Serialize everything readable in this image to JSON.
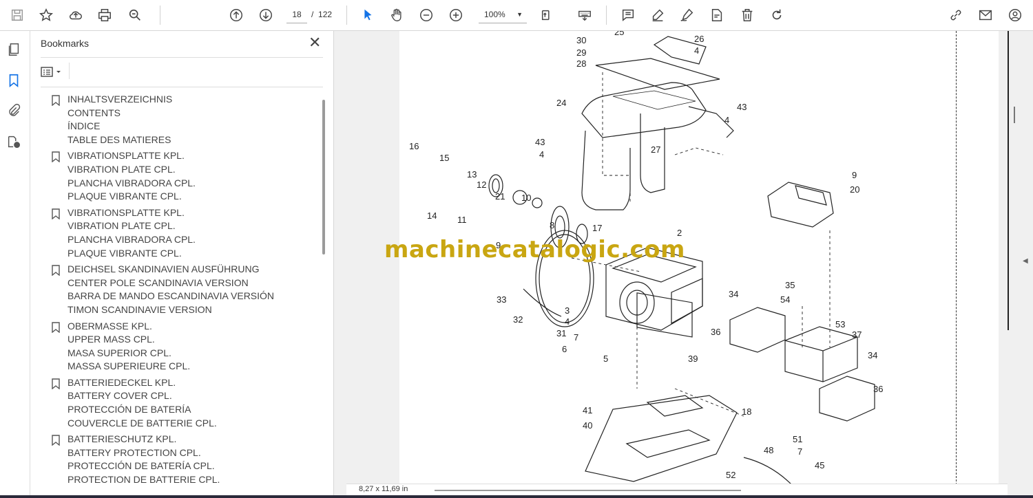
{
  "toolbar": {
    "icons": [
      "save-icon",
      "star-icon",
      "upload-cloud-icon",
      "print-icon",
      "zoom-search-icon",
      "page-up-icon",
      "page-down-icon",
      "select-arrow-icon",
      "hand-icon",
      "zoom-out-icon",
      "zoom-in-icon",
      "fit-page-icon",
      "keyboard-icon",
      "comment-icon",
      "highlight-pen-icon",
      "sign-pen-icon",
      "edit-stamp-icon",
      "trash-icon",
      "rotate-icon",
      "link-share-icon",
      "email-icon",
      "account-icon"
    ],
    "current_page": "18",
    "page_separator": "/",
    "total_pages": "122",
    "zoom_value": "100%"
  },
  "rail": {
    "icons": [
      "pages-icon",
      "bookmark-icon",
      "attachment-icon",
      "layers-lock-icon"
    ]
  },
  "bookmarks_panel": {
    "title": "Bookmarks",
    "items": [
      {
        "lines": [
          "INHALTSVERZEICHNIS",
          "CONTENTS",
          "ÍNDICE",
          "TABLE DES MATIERES"
        ]
      },
      {
        "lines": [
          "VIBRATIONSPLATTE KPL.",
          "VIBRATION PLATE CPL.",
          "PLANCHA VIBRADORA CPL.",
          "PLAQUE VIBRANTE CPL."
        ]
      },
      {
        "lines": [
          "VIBRATIONSPLATTE KPL.",
          "VIBRATION PLATE CPL.",
          "PLANCHA VIBRADORA CPL.",
          "PLAQUE VIBRANTE CPL."
        ]
      },
      {
        "lines": [
          "DEICHSEL SKANDINAVIEN AUSFÜHRUNG",
          "CENTER POLE SCANDINAVIA VERSION",
          "BARRA DE MANDO ESCANDINAVIA VERSIÓN",
          "TIMON SCANDINAVIE VERSION"
        ]
      },
      {
        "lines": [
          "OBERMASSE KPL.",
          "UPPER MASS CPL.",
          "MASA SUPERIOR CPL.",
          "MASSA SUPERIEURE CPL."
        ]
      },
      {
        "lines": [
          "BATTERIEDECKEL KPL.",
          "BATTERY COVER CPL.",
          "PROTECCIÓN DE BATERÍA",
          "COUVERCLE DE BATTERIE CPL."
        ]
      },
      {
        "lines": [
          "BATTERIESCHUTZ KPL.",
          "BATTERY PROTECTION CPL.",
          "PROTECCIÓN DE BATERÍA CPL.",
          "PROTECTION DE BATTERIE CPL."
        ]
      }
    ]
  },
  "document": {
    "watermark": "machinecatalogic.com",
    "page_size": "8,27 x 11,69 in",
    "part_numbers": [
      "30",
      "29",
      "28",
      "25",
      "26",
      "4",
      "24",
      "43",
      "4",
      "27",
      "43",
      "4",
      "16",
      "15",
      "13",
      "12",
      "14",
      "11",
      "21",
      "10",
      "9",
      "20",
      "8",
      "17",
      "2",
      "9",
      "33",
      "32",
      "3",
      "4",
      "31",
      "7",
      "6",
      "5",
      "35",
      "34",
      "54",
      "53",
      "36",
      "37",
      "39",
      "34",
      "36",
      "18",
      "41",
      "40",
      "48",
      "51",
      "7",
      "52",
      "45"
    ]
  },
  "colors": {
    "accent": "#1473e6",
    "watermark": "#c9a612"
  }
}
